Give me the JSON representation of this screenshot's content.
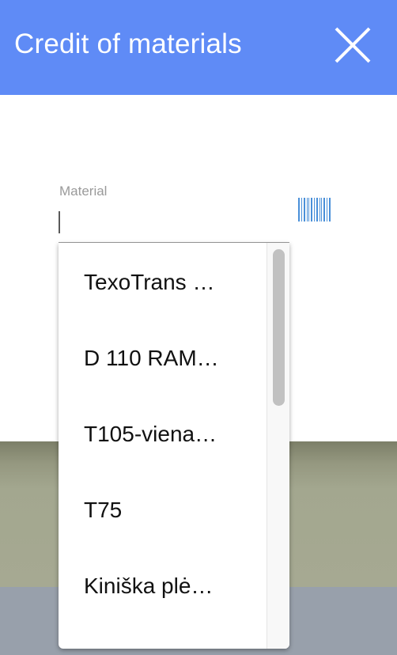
{
  "header": {
    "title": "Credit of materials",
    "close_icon": "close-icon"
  },
  "form": {
    "material_label": "Material",
    "material_value": "",
    "barcode_icon": "barcode-icon"
  },
  "dropdown": {
    "options": [
      "TexoTrans …",
      "D 110 RAM…",
      "T105-viena…",
      "T75",
      "Kiniška plė…"
    ]
  },
  "colors": {
    "header_bg": "#5f8bf6",
    "header_text": "#ffffff",
    "barcode": "#4a90d9"
  }
}
